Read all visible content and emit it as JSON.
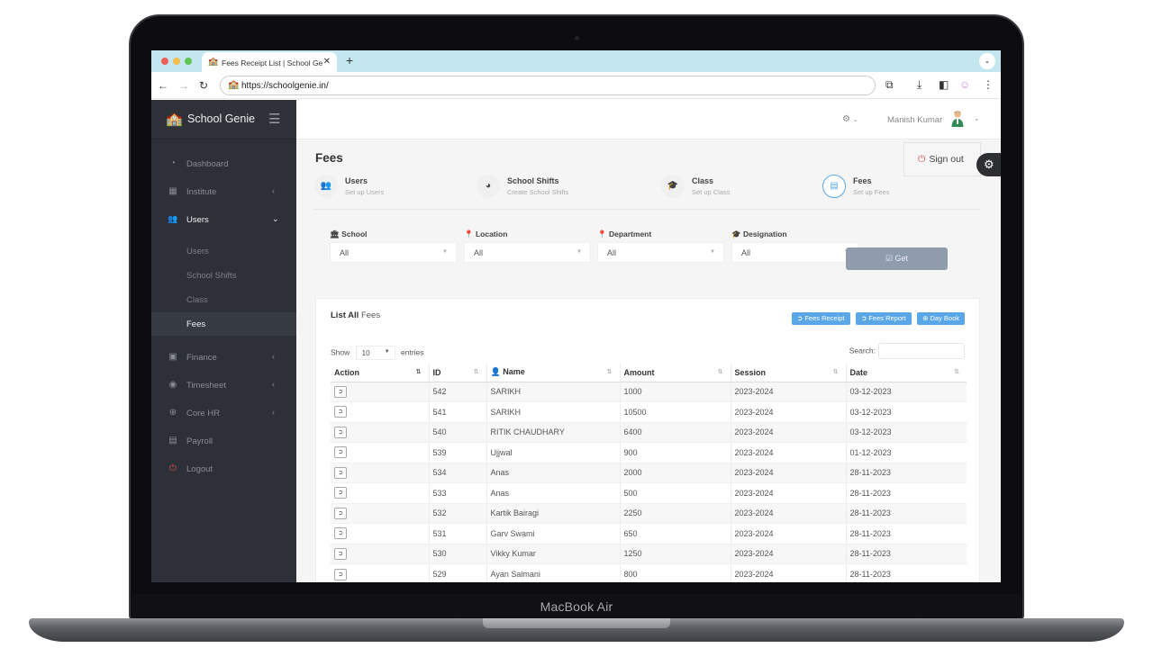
{
  "device": {
    "brand_label": "MacBook Air"
  },
  "browser": {
    "tab_title": "Fees Receipt List | School Genie",
    "tab_title_visible": "Fees Receipt List | School Ge",
    "url": "https://schoolgenie.in/",
    "new_tab_label": "+",
    "tab_close_label": "✕"
  },
  "app": {
    "name": "School Genie",
    "user_name": "Manish Kumar"
  },
  "sidebar": {
    "items": [
      {
        "label": "Dashboard",
        "icon": "dashboard-icon",
        "glyph": "◔",
        "chevron": ""
      },
      {
        "label": "Institute",
        "icon": "building-icon",
        "glyph": "▦",
        "chevron": "‹"
      },
      {
        "label": "Users",
        "icon": "users-icon",
        "glyph": "👥",
        "chevron": "⌄"
      },
      {
        "label": "Finance",
        "icon": "money-icon",
        "glyph": "▣",
        "chevron": "‹"
      },
      {
        "label": "Timesheet",
        "icon": "clock-icon",
        "glyph": "◉",
        "chevron": "‹"
      },
      {
        "label": "Core HR",
        "icon": "globe-icon",
        "glyph": "⊕",
        "chevron": "‹"
      },
      {
        "label": "Payroll",
        "icon": "calculator-icon",
        "glyph": "▤",
        "chevron": ""
      },
      {
        "label": "Logout",
        "icon": "power-icon",
        "glyph": "⏻",
        "chevron": ""
      }
    ],
    "sub_items": [
      {
        "label": "Users"
      },
      {
        "label": "School Shifts"
      },
      {
        "label": "Class"
      },
      {
        "label": "Fees"
      }
    ]
  },
  "page": {
    "title": "Fees",
    "sign_out_label": "Sign out"
  },
  "steps": [
    {
      "title": "Users",
      "subtitle": "Set up Users",
      "glyph": "👥"
    },
    {
      "title": "School Shifts",
      "subtitle": "Create School Shifts",
      "glyph": "◕"
    },
    {
      "title": "Class",
      "subtitle": "Set up Class",
      "glyph": "🎓"
    },
    {
      "title": "Fees",
      "subtitle": "Set up Fees",
      "glyph": "▤"
    }
  ],
  "filters": [
    {
      "label": "School",
      "glyph": "🏛",
      "value": "All"
    },
    {
      "label": "Location",
      "glyph": "📍",
      "value": "All"
    },
    {
      "label": "Department",
      "glyph": "📍",
      "value": "All"
    },
    {
      "label": "Designation",
      "glyph": "🎓",
      "value": "All"
    }
  ],
  "get_button_label": "Get",
  "list": {
    "title_bold": "List All",
    "title_rest": "Fees",
    "buttons": [
      "Fees Receipt",
      "Fees Report",
      "Day Book"
    ],
    "show_label": "Show",
    "page_length": "10",
    "entries_label": "entries",
    "search_label": "Search:",
    "search_value": "",
    "columns": [
      "Action",
      "ID",
      "Name",
      "Amount",
      "Session",
      "Date"
    ],
    "rows": [
      {
        "id": "542",
        "name": "SARIKH",
        "amount": "1000",
        "session": "2023-2024",
        "date": "03-12-2023"
      },
      {
        "id": "541",
        "name": "SARIKH",
        "amount": "10500",
        "session": "2023-2024",
        "date": "03-12-2023"
      },
      {
        "id": "540",
        "name": "RITIK CHAUDHARY",
        "amount": "6400",
        "session": "2023-2024",
        "date": "03-12-2023"
      },
      {
        "id": "539",
        "name": "Ujjwal",
        "amount": "900",
        "session": "2023-2024",
        "date": "01-12-2023"
      },
      {
        "id": "534",
        "name": "Anas",
        "amount": "2000",
        "session": "2023-2024",
        "date": "28-11-2023"
      },
      {
        "id": "533",
        "name": "Anas",
        "amount": "500",
        "session": "2023-2024",
        "date": "28-11-2023"
      },
      {
        "id": "532",
        "name": "Kartik Bairagi",
        "amount": "2250",
        "session": "2023-2024",
        "date": "28-11-2023"
      },
      {
        "id": "531",
        "name": "Garv Swami",
        "amount": "650",
        "session": "2023-2024",
        "date": "28-11-2023"
      },
      {
        "id": "530",
        "name": "Vikky Kumar",
        "amount": "1250",
        "session": "2023-2024",
        "date": "28-11-2023"
      },
      {
        "id": "529",
        "name": "Ayan Salmani",
        "amount": "800",
        "session": "2023-2024",
        "date": "28-11-2023"
      }
    ]
  },
  "colors": {
    "sidebar_bg": "#2d3038",
    "accent_blue": "#5aa7e8",
    "get_button": "#8e9cac",
    "logout_red": "#d9534f"
  }
}
